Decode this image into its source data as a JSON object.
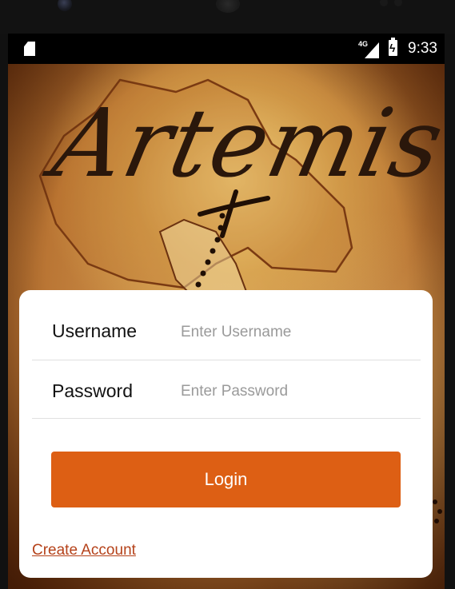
{
  "status_bar": {
    "network_label": "4G",
    "time": "9:33",
    "icons": [
      "sd-card-icon",
      "signal-icon",
      "battery-charging-icon"
    ]
  },
  "app": {
    "logo_text": "Artemis"
  },
  "login_form": {
    "username": {
      "label": "Username",
      "placeholder": "Enter Username",
      "value": ""
    },
    "password": {
      "label": "Password",
      "placeholder": "Enter Password",
      "value": ""
    },
    "login_button_label": "Login",
    "create_account_label": "Create Account"
  },
  "colors": {
    "accent": "#dd5f14",
    "link": "#b5421a",
    "card_bg": "#ffffff",
    "status_bar_bg": "#000000"
  }
}
